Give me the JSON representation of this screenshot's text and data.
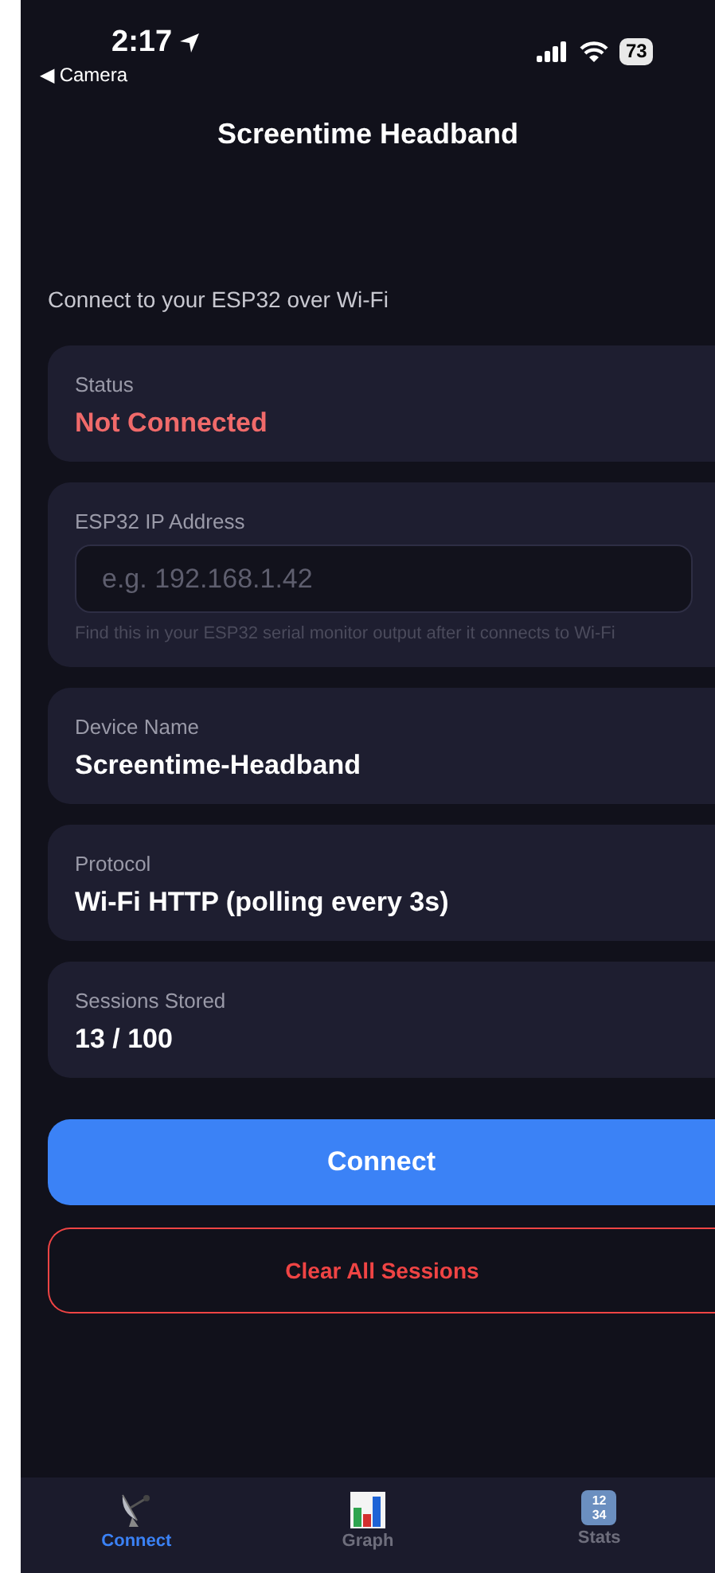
{
  "status_bar": {
    "time": "2:17",
    "back_label": "◀ Camera",
    "battery": "73"
  },
  "title": "Screentime Headband",
  "subtitle": "Connect to your ESP32 over Wi-Fi",
  "status": {
    "label": "Status",
    "value": "Not Connected",
    "connected": false
  },
  "ip": {
    "label": "ESP32 IP Address",
    "placeholder": "e.g. 192.168.1.42",
    "hint": "Find this in your ESP32 serial monitor output after it connects to Wi-Fi"
  },
  "info_cards": [
    {
      "label": "Device Name",
      "value": "Screentime-Headband"
    },
    {
      "label": "Protocol",
      "value": "Wi-Fi HTTP (polling every 3s)"
    },
    {
      "label": "Sessions Stored",
      "value": "13 / 100"
    }
  ],
  "buttons": [
    {
      "kind": "primary",
      "label": "Connect"
    },
    {
      "kind": "danger",
      "label": "Clear All Sessions"
    }
  ],
  "tabs": [
    {
      "kind": "dish",
      "label": "Connect",
      "selected": true
    },
    {
      "kind": "chart",
      "label": "Graph",
      "selected": false
    },
    {
      "kind": "numbers",
      "label": "Stats",
      "selected": false,
      "icon_lines": [
        "12",
        "34"
      ]
    }
  ]
}
